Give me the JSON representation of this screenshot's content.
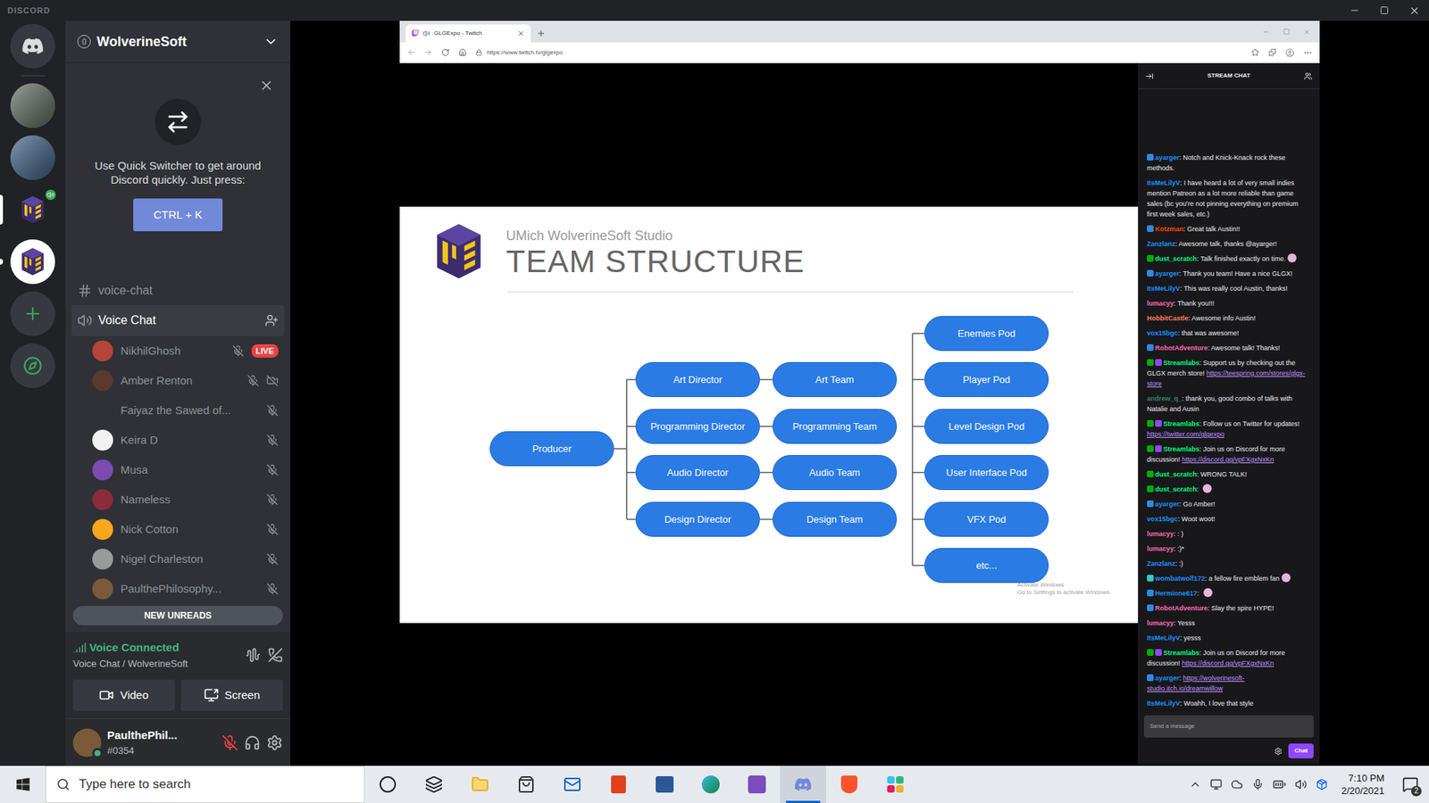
{
  "app": {
    "title": "DISCORD"
  },
  "servers": [
    {
      "kind": "home",
      "selected": false,
      "unread": false,
      "speaking": false,
      "color": "#36393f"
    },
    {
      "kind": "photo",
      "selected": false,
      "unread": false,
      "speaking": false,
      "color": "#6f7a70"
    },
    {
      "kind": "photo",
      "selected": false,
      "unread": false,
      "speaking": false,
      "color": "#4d6f94"
    },
    {
      "kind": "logo",
      "selected": true,
      "unread": false,
      "speaking": true,
      "color": "#202225"
    },
    {
      "kind": "logo",
      "selected": false,
      "unread": true,
      "speaking": false,
      "color": "#ffffff"
    },
    {
      "kind": "add",
      "selected": false,
      "unread": false,
      "speaking": false,
      "color": "#36393f"
    },
    {
      "kind": "explore",
      "selected": false,
      "unread": false,
      "speaking": false,
      "color": "#36393f"
    }
  ],
  "server": {
    "name": "WolverineSoft",
    "boosts": "0"
  },
  "quick_switcher": {
    "text": "Use Quick Switcher to get around Discord quickly. Just press:",
    "shortcut": "CTRL + K"
  },
  "channels": [
    {
      "name": "voice-chat",
      "kind": "text",
      "selected": false
    },
    {
      "name": "Voice Chat",
      "kind": "voice",
      "selected": true
    }
  ],
  "labels": {
    "live": "LIVE",
    "new_unreads": "NEW UNREADS"
  },
  "voice_users": [
    {
      "name": "NikhilGhosh",
      "color": "#b5443a",
      "muted": true,
      "video_off": false,
      "live": true
    },
    {
      "name": "Amber Renton",
      "color": "#5a3a2e",
      "muted": true,
      "video_off": true,
      "live": false
    },
    {
      "name": "Faiyaz the Sawed of...",
      "color": "#2f3136",
      "muted": true,
      "video_off": false,
      "live": false
    },
    {
      "name": "Keira D",
      "color": "#f2f2f2",
      "muted": true,
      "video_off": false,
      "live": false
    },
    {
      "name": "Musa",
      "color": "#7b4bb0",
      "muted": true,
      "video_off": false,
      "live": false
    },
    {
      "name": "Nameless",
      "color": "#8a2c3a",
      "muted": true,
      "video_off": false,
      "live": false
    },
    {
      "name": "Nick Cotton",
      "color": "#faa61a",
      "muted": true,
      "video_off": false,
      "live": false
    },
    {
      "name": "Nigel Charleston",
      "color": "#9a9a9a",
      "muted": true,
      "video_off": false,
      "live": false
    },
    {
      "name": "PaulthePhilosophy...",
      "color": "#7a5a3a",
      "muted": true,
      "video_off": false,
      "live": false
    }
  ],
  "voice_status": {
    "status": "Voice Connected",
    "location": "Voice Chat / WolverineSoft"
  },
  "voice_buttons": [
    {
      "label": "Video",
      "kind": "video"
    },
    {
      "label": "Screen",
      "kind": "screen"
    }
  ],
  "user": {
    "name": "PaulthePhil...",
    "tag": "#0354",
    "mic_muted": true,
    "color": "#7a5a3a"
  },
  "browser": {
    "tab": "GLGExpo - Twitch",
    "url": "https://www.twitch.tv/glgexpo"
  },
  "slide": {
    "subtitle": "UMich WolverineSoft Studio",
    "title": "TEAM STRUCTURE",
    "root": "Producer",
    "directors": [
      "Art Director",
      "Programming Director",
      "Audio Director",
      "Design Director"
    ],
    "teams": [
      "Art Team",
      "Programming Team",
      "Audio Team",
      "Design Team"
    ],
    "pods": [
      "Enemies Pod",
      "Player Pod",
      "Level Design Pod",
      "User Interface Pod",
      "VFX Pod",
      "etc..."
    ],
    "watermark": [
      "Activate Windows",
      "Go to Settings to activate Windows."
    ]
  },
  "chat": {
    "title": "STREAM CHAT",
    "sep": ":",
    "placeholder": "Send a message",
    "send": "Chat",
    "messages": [
      {
        "user": "ayarger",
        "color": "#1e90ff",
        "badges": [
          "blue"
        ],
        "text": "Notch and Knick-Knack rock these methods.",
        "emote": false
      },
      {
        "user": "ItsMeLilyV",
        "color": "#1e90ff",
        "badges": [],
        "text": "I have heard a lot of very small indies mention Patreon as a lot more reliable than game sales (bc you're not pinning everything on premium first week sales, etc.)",
        "emote": false
      },
      {
        "user": "Kotzman",
        "color": "#ff4500",
        "badges": [
          "blue"
        ],
        "text": "Great talk Austin!!",
        "emote": false
      },
      {
        "user": "Zanzlanz",
        "color": "#1e90ff",
        "badges": [],
        "text": "Awesome talk, thanks @ayarger!",
        "emote": false
      },
      {
        "user": "dust_scratch",
        "color": "#00ff7f",
        "badges": [
          "green"
        ],
        "text": "Talk finished exactly on time.",
        "emote": true
      },
      {
        "user": "ayarger",
        "color": "#1e90ff",
        "badges": [
          "blue"
        ],
        "text": "Thank you team! Have a nice GLGX!",
        "emote": false
      },
      {
        "user": "ItsMeLilyV",
        "color": "#1e90ff",
        "badges": [],
        "text": "This was really cool Austin, thanks!",
        "emote": false
      },
      {
        "user": "lumacyy",
        "color": "#ff69b4",
        "badges": [],
        "text": "Thank you!!!",
        "emote": false
      },
      {
        "user": "HobbitCastle",
        "color": "#ff7f50",
        "badges": [],
        "text": "Awesome info Austin!",
        "emote": false
      },
      {
        "user": "vox15bgc",
        "color": "#1e90ff",
        "badges": [],
        "text": "that was awesome!",
        "emote": false
      },
      {
        "user": "RobotAdventure",
        "color": "#ff69b4",
        "badges": [
          "blue"
        ],
        "text": "Awesome talk! Thanks!",
        "emote": false
      },
      {
        "user": "Streamlabs",
        "color": "#00ff7f",
        "badges": [
          "green",
          "bot"
        ],
        "text": "Support us by checking out the GLGX merch store!",
        "link": "https://teespring.com/stores/glgx-store",
        "emote": false
      },
      {
        "user": "andrew_q_",
        "color": "#2e8b57",
        "badges": [],
        "text": "thank you, good combo of talks with Natalie and Ausin",
        "emote": false
      },
      {
        "user": "Streamlabs",
        "color": "#00ff7f",
        "badges": [
          "green",
          "bot"
        ],
        "text": "Follow us on Twitter for updates!",
        "link": "https://twitter.com/glgexpo",
        "emote": false
      },
      {
        "user": "Streamlabs",
        "color": "#00ff7f",
        "badges": [
          "green",
          "bot"
        ],
        "text": "Join us on Discord for more discussion!",
        "link": "https://discord.gg/vpFXgxNxKn",
        "emote": false
      },
      {
        "user": "dust_scratch",
        "color": "#00ff7f",
        "badges": [
          "green"
        ],
        "text": "WRONG TALK!",
        "emote": false
      },
      {
        "user": "dust_scratch",
        "color": "#00ff7f",
        "badges": [
          "green"
        ],
        "text": "",
        "emote": true
      },
      {
        "user": "ayarger",
        "color": "#1e90ff",
        "badges": [
          "blue"
        ],
        "text": "Go Amber!",
        "emote": false
      },
      {
        "user": "vox15bgc",
        "color": "#1e90ff",
        "badges": [],
        "text": "Woot woot!",
        "emote": false
      },
      {
        "user": "lumacyy",
        "color": "#ff69b4",
        "badges": [],
        "text": ": )",
        "emote": false
      },
      {
        "user": "lumacyy",
        "color": "#ff69b4",
        "badges": [],
        "text": ":)*",
        "emote": false
      },
      {
        "user": "Zanzlanz",
        "color": "#1e90ff",
        "badges": [],
        "text": ":)",
        "emote": false
      },
      {
        "user": "wombatwolf172",
        "color": "#1e90ff",
        "badges": [
          "star"
        ],
        "text": "a fellow fire emblem fan",
        "emote": true
      },
      {
        "user": "Hermione617",
        "color": "#1e90ff",
        "badges": [
          "blue"
        ],
        "text": "",
        "emote": true
      },
      {
        "user": "RobotAdventure",
        "color": "#ff69b4",
        "badges": [
          "blue"
        ],
        "text": "Slay the spire HYPE!",
        "emote": false
      },
      {
        "user": "lumacyy",
        "color": "#ff69b4",
        "badges": [],
        "text": "Yesss",
        "emote": false
      },
      {
        "user": "ItsMeLilyV",
        "color": "#1e90ff",
        "badges": [],
        "text": "yesss",
        "emote": false
      },
      {
        "user": "Streamlabs",
        "color": "#00ff7f",
        "badges": [
          "green",
          "bot"
        ],
        "text": "Join us on Discord for more discussion!",
        "link": "https://discord.gg/vpFXgxNxKn",
        "emote": false
      },
      {
        "user": "ayarger",
        "color": "#1e90ff",
        "badges": [
          "blue"
        ],
        "text": "",
        "link": "https://wolverinesoft-studio.itch.io/dreamwillow",
        "emote": false
      },
      {
        "user": "ItsMeLilyV",
        "color": "#1e90ff",
        "badges": [],
        "text": "Woahh, I love that style",
        "emote": false
      }
    ]
  },
  "taskbar": {
    "search_placeholder": "Type here to search",
    "time": "7:10 PM",
    "date": "2/20/2021",
    "notifications": "2",
    "apps": [
      {
        "kind": "cortana",
        "active": false
      },
      {
        "kind": "taskview",
        "active": false
      },
      {
        "kind": "explorer",
        "active": false
      },
      {
        "kind": "store",
        "active": false
      },
      {
        "kind": "mail",
        "active": false
      },
      {
        "kind": "office",
        "active": false
      },
      {
        "kind": "word",
        "active": false
      },
      {
        "kind": "edge",
        "active": false
      },
      {
        "kind": "vs",
        "active": false
      },
      {
        "kind": "discord",
        "active": true
      },
      {
        "kind": "brave",
        "active": false
      },
      {
        "kind": "slack",
        "active": false
      }
    ]
  }
}
